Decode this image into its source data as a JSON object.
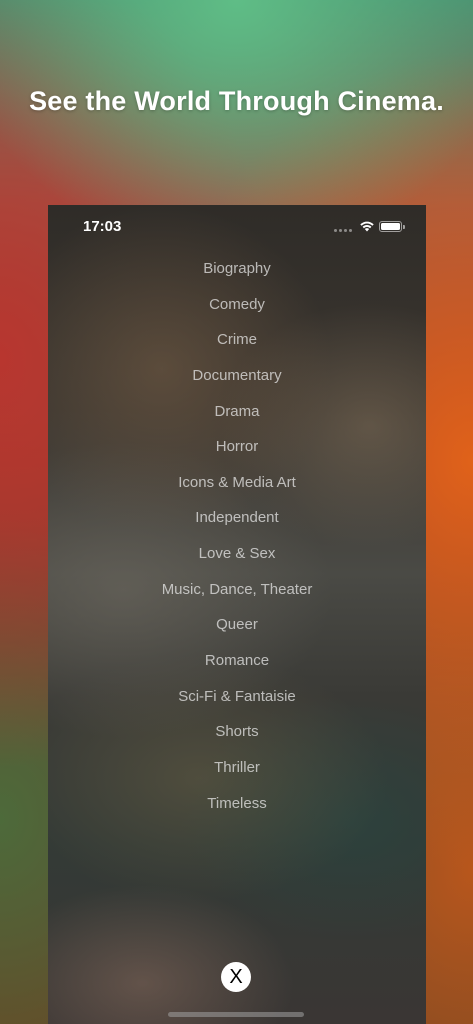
{
  "headline": "See the World Through Cinema.",
  "status_bar": {
    "time": "17:03",
    "icons": [
      "signal-icon",
      "wifi-icon",
      "battery-icon"
    ]
  },
  "genres": [
    "Biography",
    "Comedy",
    "Crime",
    "Documentary",
    "Drama",
    "Horror",
    "Icons & Media Art",
    "Independent",
    "Love & Sex",
    "Music, Dance, Theater",
    "Queer",
    "Romance",
    "Sci-Fi & Fantaisie",
    "Shorts",
    "Thriller",
    "Timeless"
  ],
  "close_button": {
    "label": "X",
    "icon": "close-icon"
  },
  "colors": {
    "headline_text": "#ffffff",
    "genre_text": "#ebebeb",
    "close_button_bg": "#ffffff"
  }
}
